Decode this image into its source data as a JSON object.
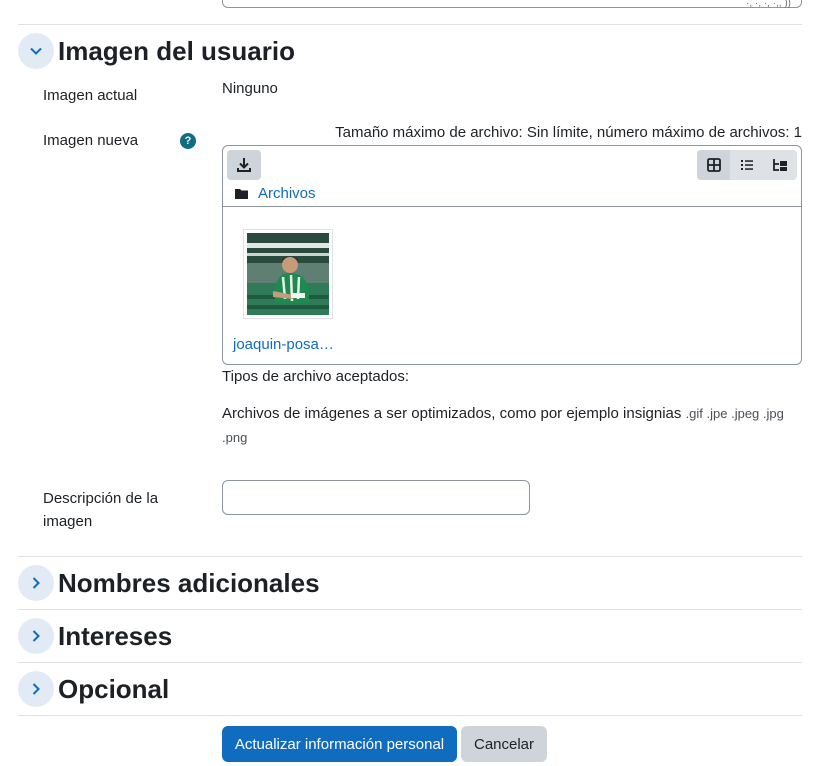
{
  "top_field": {
    "marks": "·,  ·,  ·,  ·,,  ))"
  },
  "section_user_image": {
    "title": "Imagen del usuario",
    "current_image_label": "Imagen actual",
    "current_image_value": "Ninguno",
    "new_image_label": "Imagen nueva",
    "help_symbol": "?",
    "max_info": "Tamaño máximo de archivo: Sin límite, número máximo de archivos: 1",
    "filepicker": {
      "folder_label": "Archivos",
      "file_name": "joaquin-posa…",
      "views": [
        "icons-view",
        "list-view",
        "tree-view"
      ]
    },
    "accepted_types_label": "Tipos de archivo aceptados:",
    "accepted_desc": "Archivos de imágenes a ser optimizados, como por ejemplo insignias",
    "accepted_exts_line1": ".gif .jpe .jpeg .jpg",
    "accepted_exts_line2": ".png",
    "description_label_line1": "Descripción de la",
    "description_label_line2": "imagen",
    "description_value": ""
  },
  "sections": {
    "additional_names": "Nombres adicionales",
    "interests": "Intereses",
    "optional": "Opcional"
  },
  "buttons": {
    "submit": "Actualizar información personal",
    "cancel": "Cancelar"
  },
  "colors": {
    "link": "#0f6cbf",
    "primary": "#0f6cbf",
    "toggle_bg": "#e2ebf5",
    "help": "#0f6e84"
  }
}
